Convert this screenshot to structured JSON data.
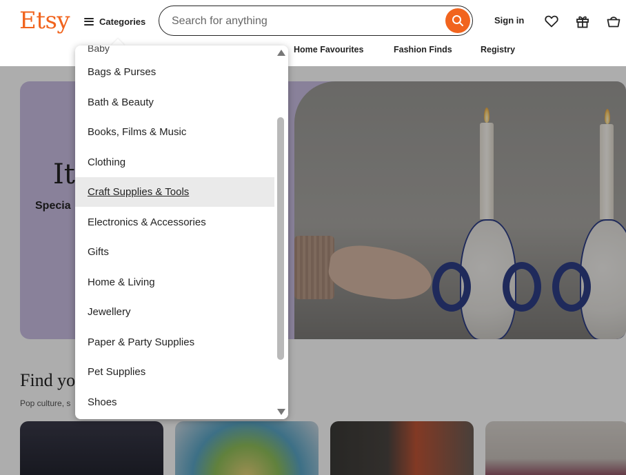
{
  "header": {
    "logo": "Etsy",
    "categories_label": "Categories",
    "search_placeholder": "Search for anything",
    "sign_in": "Sign in"
  },
  "subnav": [
    "Home Favourites",
    "Fashion Finds",
    "Registry"
  ],
  "hero": {
    "title_partial": "It",
    "subtitle_partial": "Specia"
  },
  "find_section": {
    "title_partial": "Find yo",
    "subtitle_partial": "Pop culture, s"
  },
  "categories_menu": {
    "partial_top": "Baby",
    "items": [
      "Bags & Purses",
      "Bath & Beauty",
      "Books, Films & Music",
      "Clothing",
      "Craft Supplies & Tools",
      "Electronics & Accessories",
      "Gifts",
      "Home & Living",
      "Jewellery",
      "Paper & Party Supplies",
      "Pet Supplies",
      "Shoes"
    ],
    "hovered_item": "Craft Supplies & Tools"
  },
  "colors": {
    "brand_orange": "#f1641e",
    "hero_lavender": "#cbbfe4",
    "menu_hover": "#eaeaea"
  },
  "icons": [
    "menu-icon",
    "search-icon",
    "heart-icon",
    "gift-icon",
    "bag-icon",
    "scroll-up-arrow-icon",
    "scroll-down-arrow-icon"
  ]
}
